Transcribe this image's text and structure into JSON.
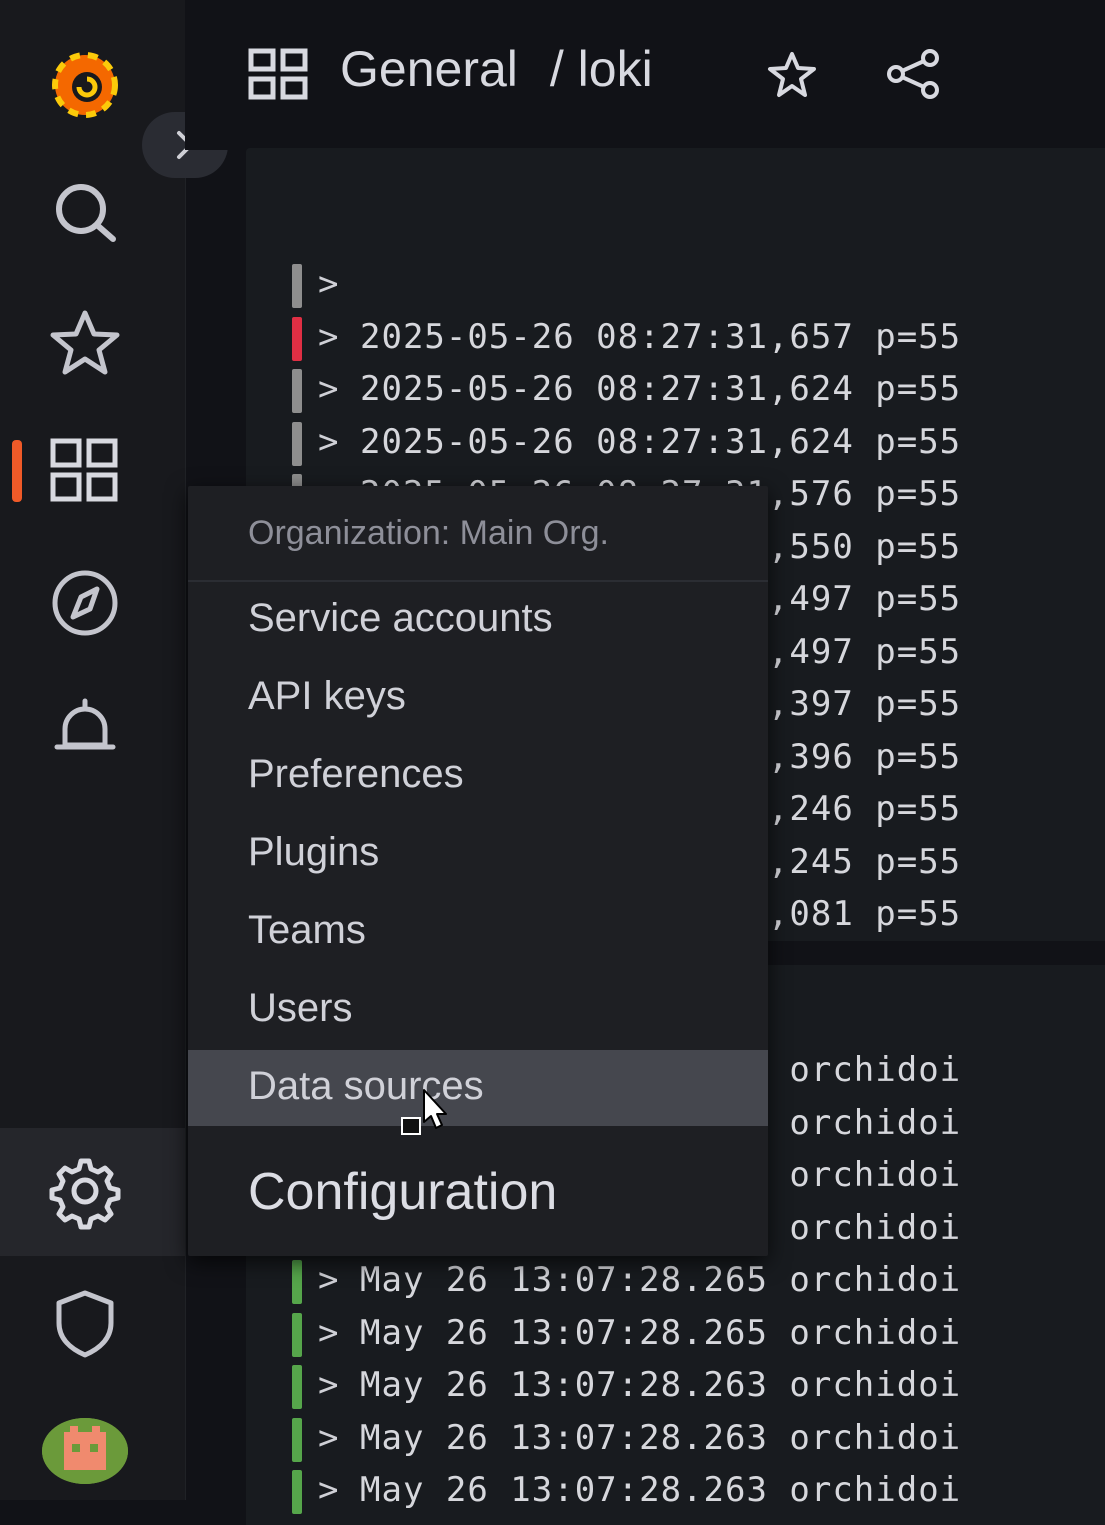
{
  "header": {
    "breadcrumb_section": "General",
    "breadcrumb_page": "/ loki"
  },
  "colors": {
    "accent": "#f05a28",
    "log_error": "#e02f44",
    "log_unknown": "#8e8e8e",
    "log_info": "#56a64b",
    "menu_hover": "#45474e"
  },
  "logs_top": [
    {
      "text": ""
    },
    {
      "text": "2025-05-26 08:27:31,657 p=55"
    },
    {
      "text": "2025-05-26 08:27:31,624 p=55"
    },
    {
      "text": "2025-05-26 08:27:31,624 p=55"
    },
    {
      "text": "2025-05-26 08:27:31,576 p=55"
    },
    {
      "text": "2025-05-26 08:27:31,550 p=55"
    },
    {
      "text": "2025-05-26 08:27:31,497 p=55"
    },
    {
      "text": "2025-05-26 08:27:31,497 p=55"
    },
    {
      "text": "2025-05-26 08:27:31,397 p=55"
    },
    {
      "text": "2025-05-26 08:27:31,396 p=55"
    },
    {
      "text": "2025-05-26 08:27:31,246 p=55"
    },
    {
      "text": "2025-05-26 08:27:31,245 p=55"
    },
    {
      "text": "2025-05-26 08:27:31,081 p=55"
    }
  ],
  "logs_bottom": [
    {
      "text": "May 26 13:07:28.265 orchidoi"
    },
    {
      "text": "May 26 13:07:28.265 orchidoi"
    },
    {
      "text": "May 26 13:07:28.265 orchidoi"
    },
    {
      "text": "May 26 13:07:28.265 orchidoi"
    },
    {
      "text": "May 26 13:07:28.265 orchidoi"
    },
    {
      "text": "May 26 13:07:28.265 orchidoi"
    },
    {
      "text": "May 26 13:07:28.263 orchidoi"
    },
    {
      "text": "May 26 13:07:28.263 orchidoi"
    },
    {
      "text": "May 26 13:07:28.263 orchidoi"
    }
  ],
  "menu": {
    "header": "Organization: Main Org.",
    "items": [
      {
        "label": "Service accounts"
      },
      {
        "label": "API keys"
      },
      {
        "label": "Preferences"
      },
      {
        "label": "Plugins"
      },
      {
        "label": "Teams"
      },
      {
        "label": "Users"
      },
      {
        "label": "Data sources"
      }
    ],
    "footer": "Configuration"
  },
  "sidebar": {
    "icons": [
      "grafana-logo-icon",
      "search-icon",
      "star-icon",
      "dashboards-icon",
      "explore-icon",
      "alerting-icon",
      "configuration-icon",
      "shield-icon"
    ]
  }
}
